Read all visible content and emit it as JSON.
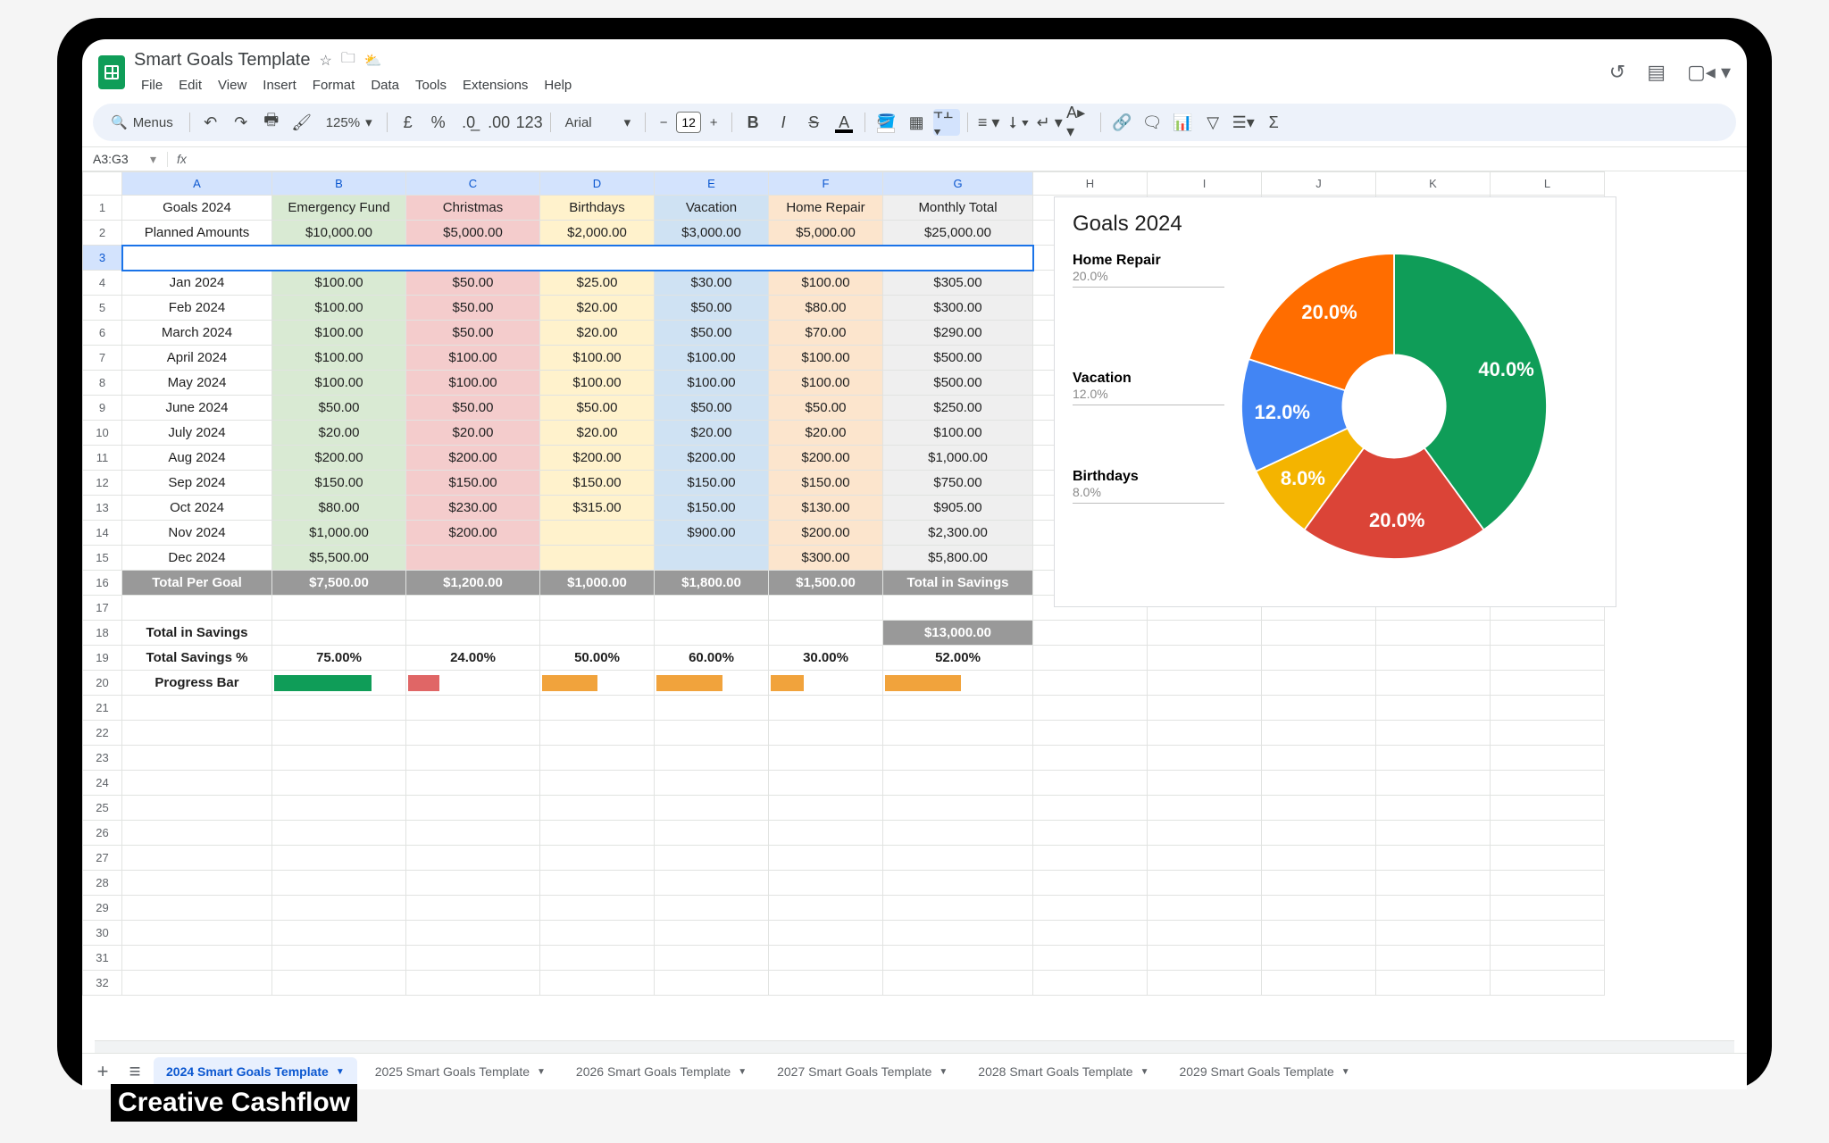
{
  "app": {
    "title": "Smart Goals Template",
    "menus": [
      "File",
      "Edit",
      "View",
      "Insert",
      "Format",
      "Data",
      "Tools",
      "Extensions",
      "Help"
    ]
  },
  "toolbar": {
    "menus_label": "Menus",
    "zoom": "125%",
    "font": "Arial",
    "font_size": "12"
  },
  "name_box": "A3:G3",
  "columns": [
    "A",
    "B",
    "C",
    "D",
    "E",
    "F",
    "G",
    "H",
    "I",
    "J",
    "K",
    "L"
  ],
  "selected_cols": [
    "A",
    "B",
    "C",
    "D",
    "E",
    "F",
    "G"
  ],
  "header_row": {
    "a": "Goals 2024",
    "b": "Emergency Fund",
    "c": "Christmas",
    "d": "Birthdays",
    "e": "Vacation",
    "f": "Home Repair",
    "g": "Monthly Total"
  },
  "planned_row": {
    "label": "Planned Amounts",
    "b": "$10,000.00",
    "c": "$5,000.00",
    "d": "$2,000.00",
    "e": "$3,000.00",
    "f": "$5,000.00",
    "g": "$25,000.00"
  },
  "months": [
    {
      "m": "Jan 2024",
      "b": "$100.00",
      "c": "$50.00",
      "d": "$25.00",
      "e": "$30.00",
      "f": "$100.00",
      "g": "$305.00"
    },
    {
      "m": "Feb 2024",
      "b": "$100.00",
      "c": "$50.00",
      "d": "$20.00",
      "e": "$50.00",
      "f": "$80.00",
      "g": "$300.00"
    },
    {
      "m": "March 2024",
      "b": "$100.00",
      "c": "$50.00",
      "d": "$20.00",
      "e": "$50.00",
      "f": "$70.00",
      "g": "$290.00"
    },
    {
      "m": "April 2024",
      "b": "$100.00",
      "c": "$100.00",
      "d": "$100.00",
      "e": "$100.00",
      "f": "$100.00",
      "g": "$500.00"
    },
    {
      "m": "May 2024",
      "b": "$100.00",
      "c": "$100.00",
      "d": "$100.00",
      "e": "$100.00",
      "f": "$100.00",
      "g": "$500.00"
    },
    {
      "m": "June 2024",
      "b": "$50.00",
      "c": "$50.00",
      "d": "$50.00",
      "e": "$50.00",
      "f": "$50.00",
      "g": "$250.00"
    },
    {
      "m": "July 2024",
      "b": "$20.00",
      "c": "$20.00",
      "d": "$20.00",
      "e": "$20.00",
      "f": "$20.00",
      "g": "$100.00"
    },
    {
      "m": "Aug 2024",
      "b": "$200.00",
      "c": "$200.00",
      "d": "$200.00",
      "e": "$200.00",
      "f": "$200.00",
      "g": "$1,000.00"
    },
    {
      "m": "Sep 2024",
      "b": "$150.00",
      "c": "$150.00",
      "d": "$150.00",
      "e": "$150.00",
      "f": "$150.00",
      "g": "$750.00"
    },
    {
      "m": "Oct 2024",
      "b": "$80.00",
      "c": "$230.00",
      "d": "$315.00",
      "e": "$150.00",
      "f": "$130.00",
      "g": "$905.00"
    },
    {
      "m": "Nov 2024",
      "b": "$1,000.00",
      "c": "$200.00",
      "d": "",
      "e": "$900.00",
      "f": "$200.00",
      "g": "$2,300.00"
    },
    {
      "m": "Dec 2024",
      "b": "$5,500.00",
      "c": "",
      "d": "",
      "e": "",
      "f": "$300.00",
      "g": "$5,800.00"
    }
  ],
  "totals_row": {
    "label": "Total Per Goal",
    "b": "$7,500.00",
    "c": "$1,200.00",
    "d": "$1,000.00",
    "e": "$1,800.00",
    "f": "$1,500.00",
    "g": "Total in Savings"
  },
  "tis_row": {
    "label": "Total in Savings",
    "g": "$13,000.00"
  },
  "pct_row": {
    "label": "Total Savings %",
    "b": "75.00%",
    "c": "24.00%",
    "d": "50.00%",
    "e": "60.00%",
    "f": "30.00%",
    "g": "52.00%"
  },
  "progress_row": {
    "label": "Progress Bar",
    "bars": [
      {
        "pct": 75,
        "color": "#0f9d58"
      },
      {
        "pct": 24,
        "color": "#e06666"
      },
      {
        "pct": 50,
        "color": "#f1a33c"
      },
      {
        "pct": 60,
        "color": "#f1a33c"
      },
      {
        "pct": 30,
        "color": "#f1a33c"
      },
      {
        "pct": 52,
        "color": "#f1a33c"
      }
    ]
  },
  "sheet_tabs": [
    "2024 Smart Goals Template",
    "2025 Smart Goals Template",
    "2026 Smart Goals Template",
    "2027 Smart Goals Template",
    "2028 Smart Goals Template",
    "2029 Smart Goals Template"
  ],
  "active_tab_index": 0,
  "brand": "Creative Cashflow",
  "chart_data": {
    "type": "donut",
    "title": "Goals 2024",
    "series": [
      {
        "name": "Emergency Fund",
        "value": 10000,
        "pct": 40.0,
        "color": "#0f9d58"
      },
      {
        "name": "Christmas",
        "value": 5000,
        "pct": 20.0,
        "color": "#db4437"
      },
      {
        "name": "Birthdays",
        "value": 2000,
        "pct": 8.0,
        "color": "#f4b400"
      },
      {
        "name": "Vacation",
        "value": 3000,
        "pct": 12.0,
        "color": "#4285f4"
      },
      {
        "name": "Home Repair",
        "value": 5000,
        "pct": 20.0,
        "color": "#ff6d00"
      }
    ],
    "legend_left": [
      {
        "name": "Home Repair",
        "pct": "20.0%"
      },
      {
        "name": "Vacation",
        "pct": "12.0%"
      },
      {
        "name": "Birthdays",
        "pct": "8.0%"
      }
    ]
  }
}
